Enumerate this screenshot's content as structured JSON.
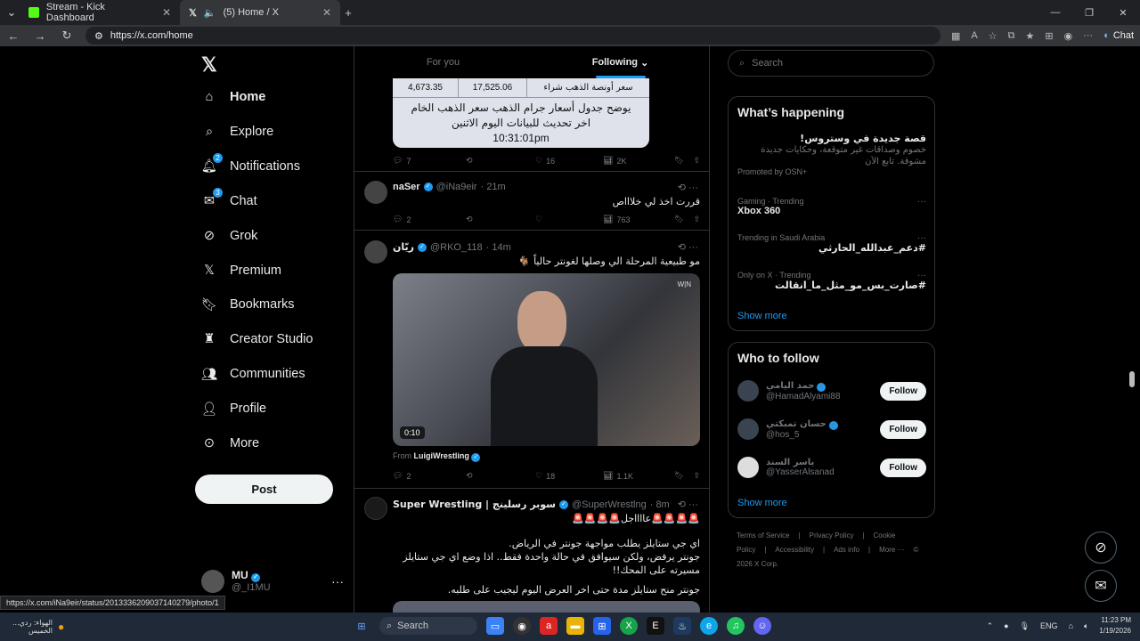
{
  "browser": {
    "tabs": [
      {
        "title": "Stream - Kick Dashboard",
        "favicon_color": "#53fc18",
        "active": false
      },
      {
        "title": "(5) Home / X",
        "favicon_color": "#e7e9ea",
        "active": true
      }
    ],
    "url": "https://x.com/home",
    "chat_label": "Chat",
    "status_url": "https://x.com/iNa9eir/status/2013336209037140279/photo/1"
  },
  "left_nav": {
    "items": [
      {
        "label": "Home",
        "icon": "home-icon"
      },
      {
        "label": "Explore",
        "icon": "search-icon"
      },
      {
        "label": "Notifications",
        "icon": "bell-icon",
        "badge": "2"
      },
      {
        "label": "Chat",
        "icon": "envelope-icon",
        "badge": "3"
      },
      {
        "label": "Grok",
        "icon": "grok-icon"
      },
      {
        "label": "Premium",
        "icon": "x-logo-icon"
      },
      {
        "label": "Bookmarks",
        "icon": "bookmark-icon"
      },
      {
        "label": "Creator Studio",
        "icon": "creator-icon"
      },
      {
        "label": "Communities",
        "icon": "people-icon"
      },
      {
        "label": "Profile",
        "icon": "person-icon"
      },
      {
        "label": "More",
        "icon": "more-circle-icon"
      }
    ],
    "post_label": "Post",
    "account": {
      "name": "MU",
      "handle": "@_I1MU"
    }
  },
  "feed": {
    "tabs": [
      {
        "label": "For you"
      },
      {
        "label": "Following"
      }
    ],
    "gold_card": {
      "cells": [
        "4,673.35",
        "17,525.06",
        "سعر أونصة الذهب شراء"
      ],
      "lines": [
        "يوضح جدول أسعار جرام الذهب سعر الذهب الخام",
        "اخر تحديث للبيانات اليوم الاثنين",
        "10:31:01pm"
      ]
    },
    "gold_actions": {
      "replies": "7",
      "likes": "16",
      "views": "2K"
    },
    "tweets": [
      {
        "name": "naSer",
        "handle": "@iNa9eir",
        "time": "· 21m",
        "text": "قررت اخذ لي خلاااص",
        "replies": "2",
        "likes": "",
        "views": "763"
      },
      {
        "name": "ريّان",
        "handle": "@RKO_118",
        "time": "· 14m",
        "text": "مو طبيعية المرحلة الي وصلها لغونتر حالياً 🐐",
        "replies": "2",
        "likes": "18",
        "views": "1.1K",
        "video_time": "0:10",
        "from_label": "From",
        "from_name": "LuigiWrestling"
      },
      {
        "name": "Super Wrestling | سوبر رسلينج",
        "handle": "@SuperWrestlng",
        "time": "· 8m",
        "line1": "🚨🚨🚨🚨عااااجل🚨🚨🚨🚨",
        "line2": "اي جي ستايلز يطلب مواجهة جونتر في الرياض.",
        "line3": "جونتر يرفض، ولكن سيوافق في حالة واحدة فقط.. اذا وضع اي جي ستايلز مسيرته على المحك!!",
        "line4": "جونتر منح ستايلز مدة حتى اخر العرض اليوم ليجيب على طلبه."
      }
    ]
  },
  "right": {
    "search_placeholder": "Search",
    "whats_happening": {
      "title": "What’s happening",
      "promo": {
        "title": "قصة جديدة في وستروس!",
        "desc": "خصوم وصداقات غير متوقعة، وحكايات جديدة مشوقة. تابع الآن",
        "promoted": "Promoted by OSN+"
      },
      "trends": [
        {
          "meta": "Gaming · Trending",
          "title": "Xbox 360",
          "rtl": false
        },
        {
          "meta": "Trending in Saudi Arabia",
          "title": "#دعم_عبدالله_الحارثي",
          "rtl": true
        },
        {
          "meta": "Only on X · Trending",
          "title": "#صارت_بس_مو_مثل_ما_انقالت",
          "rtl": true
        }
      ],
      "show_more": "Show more"
    },
    "who_to_follow": {
      "title": "Who to follow",
      "users": [
        {
          "name": "حمد اليامي",
          "handle": "@HamadAlyami88",
          "button": "Follow"
        },
        {
          "name": "حسان تمبكتي",
          "handle": "@hos_5",
          "button": "Follow"
        },
        {
          "name": "ياسر السند",
          "handle": "@YasserAlsanad",
          "button": "Follow"
        }
      ],
      "show_more": "Show more"
    },
    "footer": [
      "Terms of Service",
      "|",
      "Privacy Policy",
      "|",
      "Cookie Policy",
      "|",
      "Accessibility",
      "|",
      "Ads info",
      "|",
      "More ···",
      "© 2026 X Corp."
    ]
  },
  "taskbar": {
    "weather_title": "الهواء: ردي...",
    "weather_sub": "الخميس",
    "search_label": "Search",
    "lang": "ENG",
    "time": "11:23 PM",
    "date": "1/19/2026"
  }
}
